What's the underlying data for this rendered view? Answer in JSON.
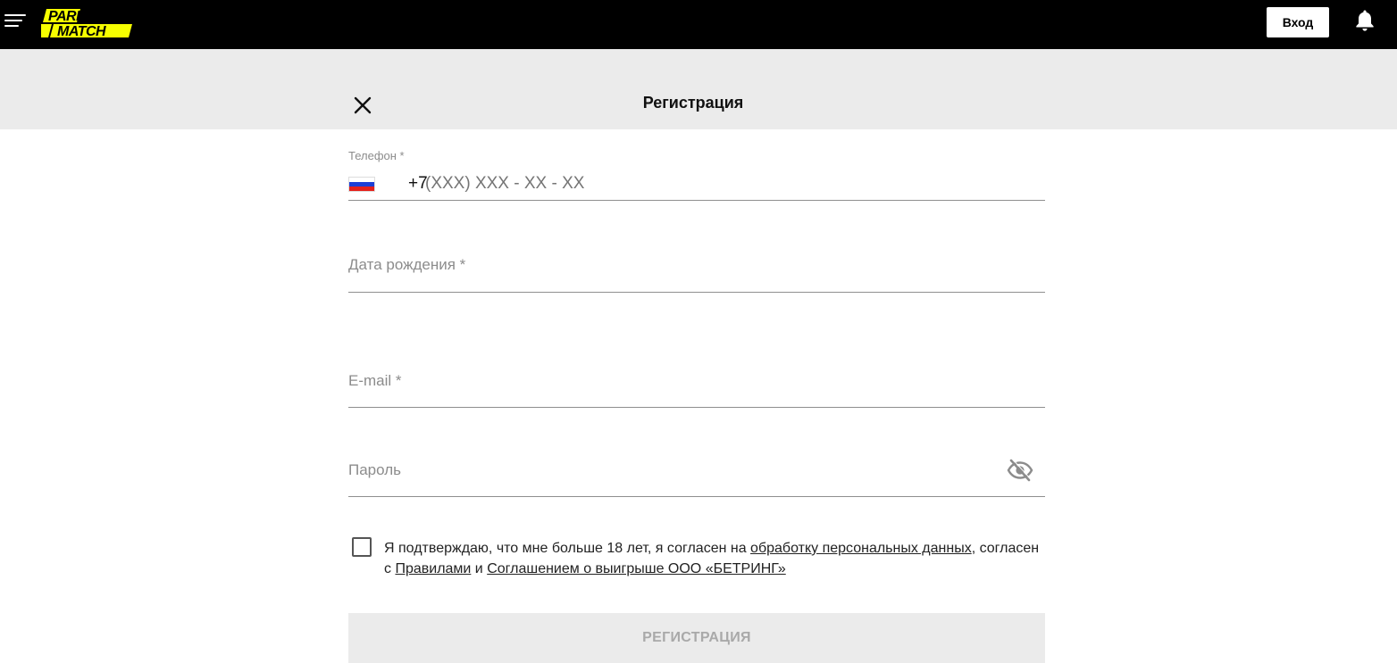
{
  "header": {
    "logo_line1": "PARI",
    "logo_line2": "MATCH",
    "login_label": "Вход",
    "colors": {
      "bar": "#000000",
      "logo_yellow": "#f6ff00"
    },
    "icons": [
      "menu-icon",
      "bell-icon"
    ]
  },
  "modal": {
    "title": "Регистрация",
    "close_icon": "close-icon"
  },
  "form": {
    "phone": {
      "label": "Телефон *",
      "country_flag": "russia-flag-icon",
      "prefix": "+7",
      "placeholder": "(XXX) XXX - XX - XX"
    },
    "birthdate": {
      "placeholder": "Дата рождения *"
    },
    "email": {
      "placeholder": "E-mail *"
    },
    "password": {
      "placeholder": "Пароль",
      "toggle_icon": "eye-off-icon"
    },
    "consent": {
      "text_1": "Я подтверждаю, что мне больше 18 лет, я согласен на ",
      "link_1": "обработку персональных данных",
      "text_2": ", согласен с ",
      "link_2": "Правилами",
      "text_3": " и ",
      "link_3": "Соглашением о выигрыше ООО «БЕТРИНГ»",
      "checked": false
    },
    "submit_label": "РЕГИСТРАЦИЯ"
  }
}
